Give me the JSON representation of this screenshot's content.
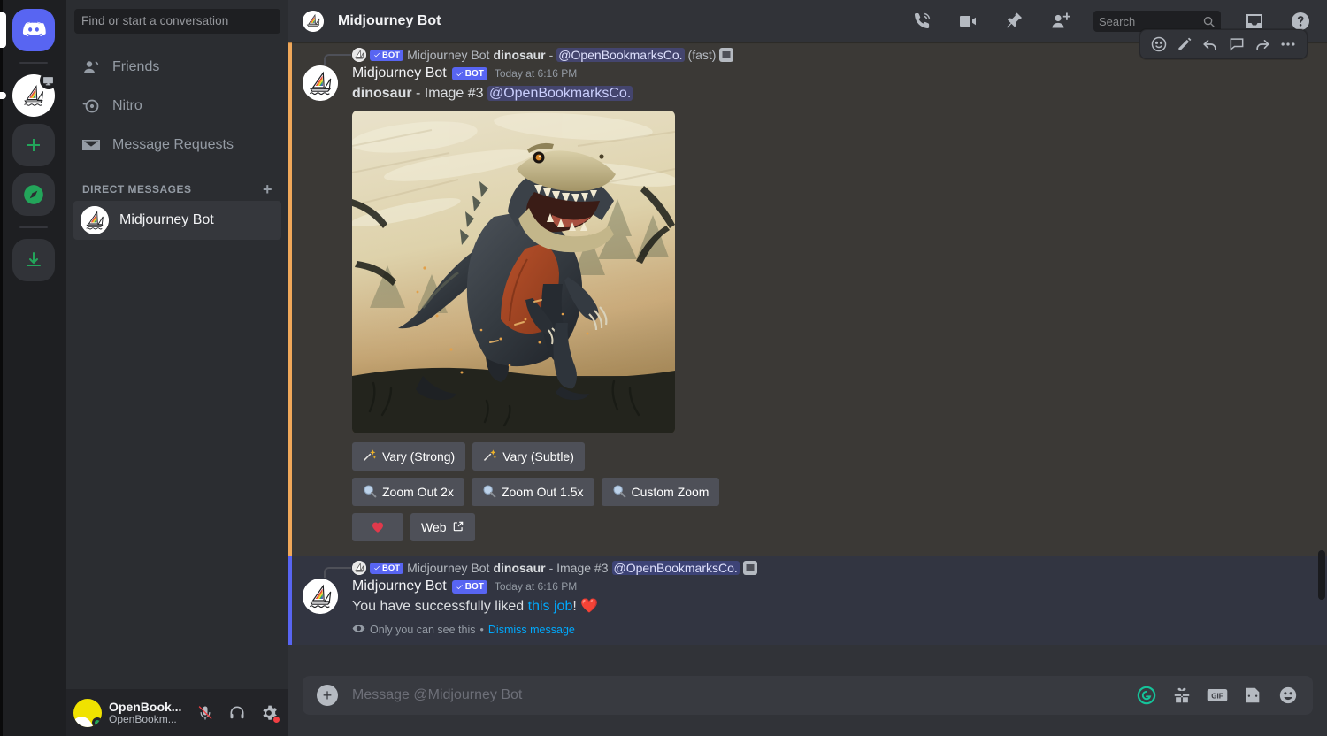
{
  "colors": {
    "brand": "#5865f2",
    "accent_orange": "#f0a85a",
    "link": "#00a8fc",
    "online_green": "#23a55a",
    "danger_red": "#f23f43"
  },
  "rail": {
    "items": [
      {
        "name": "home",
        "label": "Discord Home"
      },
      {
        "name": "midjourney-server",
        "label": "Midjourney"
      },
      {
        "name": "add-server",
        "label": "+"
      },
      {
        "name": "explore",
        "label": "Explore Public Servers"
      },
      {
        "name": "download-apps",
        "label": "Download Apps"
      }
    ]
  },
  "sidebar": {
    "search_placeholder": "Find or start a conversation",
    "nav": [
      {
        "label": "Friends",
        "icon": "friends-icon"
      },
      {
        "label": "Nitro",
        "icon": "nitro-icon"
      },
      {
        "label": "Message Requests",
        "icon": "envelope-icon"
      }
    ],
    "section_title": "DIRECT MESSAGES",
    "add_dm_label": "+",
    "dms": [
      {
        "label": "Midjourney Bot",
        "active": true
      }
    ]
  },
  "userbar": {
    "username": "OpenBook...",
    "tag": "OpenBookm...",
    "mute_label": "Mute",
    "deafen_label": "Deafen",
    "settings_label": "User Settings"
  },
  "header": {
    "title": "Midjourney Bot",
    "icons": [
      "voice-call-icon",
      "video-call-icon",
      "pin-icon",
      "add-friend-icon"
    ],
    "search_placeholder": "Search",
    "inbox_label": "Inbox",
    "help_label": "Help"
  },
  "hover_toolbar": {
    "icons": [
      "add-reaction-icon",
      "edit-icon",
      "reply-icon",
      "thread-icon",
      "forward-icon",
      "more-icon"
    ]
  },
  "messages": [
    {
      "id": "group-1",
      "accent": "orange",
      "reply": {
        "bot_badge": "BOT",
        "author": "Midjourney Bot",
        "prompt": "dinosaur",
        "separator": "-",
        "mention": "@OpenBookmarksCo.",
        "suffix": "(fast)",
        "attachment_icon": "image-attachment-icon"
      },
      "author": "Midjourney Bot",
      "bot_badge": "BOT",
      "timestamp": "Today at 6:16 PM",
      "content_prompt": "dinosaur",
      "content_separator": "- Image #3",
      "content_mention": "@OpenBookmarksCo.",
      "image_alt": "dinosaur - Image #3",
      "buttons": [
        [
          {
            "label": "Vary (Strong)",
            "icon": "sparkle-wand-icon"
          },
          {
            "label": "Vary (Subtle)",
            "icon": "sparkle-wand-icon"
          }
        ],
        [
          {
            "label": "Zoom Out 2x",
            "icon": "magnifier-icon"
          },
          {
            "label": "Zoom Out 1.5x",
            "icon": "magnifier-icon"
          },
          {
            "label": "Custom Zoom",
            "icon": "magnifier-icon"
          }
        ],
        [
          {
            "label": "",
            "icon": "heart-icon"
          },
          {
            "label": "Web",
            "icon": "external-link-icon"
          }
        ]
      ]
    },
    {
      "id": "group-2",
      "accent": "blurple",
      "reply": {
        "bot_badge": "BOT",
        "author": "Midjourney Bot",
        "prompt": "dinosaur",
        "separator": "- Image #3",
        "mention": "@OpenBookmarksCo.",
        "attachment_icon": "image-attachment-icon"
      },
      "author": "Midjourney Bot",
      "bot_badge": "BOT",
      "timestamp": "Today at 6:16 PM",
      "text_before_link": "You have successfully liked ",
      "link_text": "this job",
      "text_after_link": "! ",
      "heart_emoji": "❤️",
      "ephemeral_note": "Only you can see this",
      "ephemeral_sep": "•",
      "dismiss_label": "Dismiss message"
    }
  ],
  "composer": {
    "placeholder": "Message @Midjourney Bot",
    "icons": [
      "grammarly-icon",
      "gift-icon",
      "gif-icon",
      "sticker-icon",
      "emoji-icon"
    ],
    "gif_label": "GIF"
  }
}
